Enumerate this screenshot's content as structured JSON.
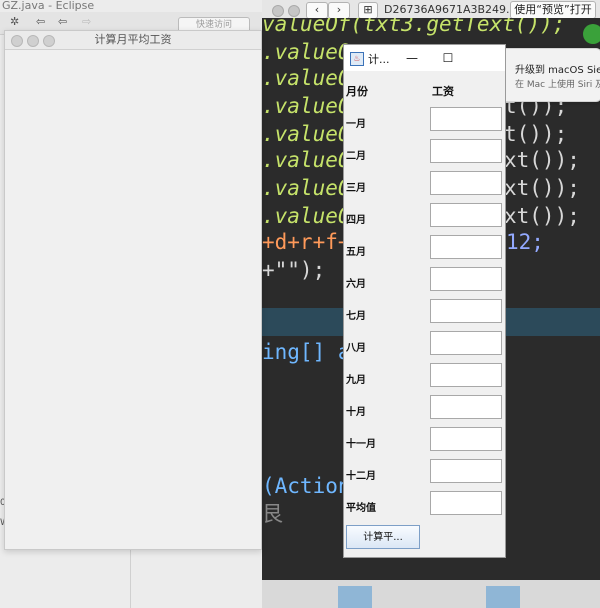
{
  "eclipse": {
    "title": "GZ.java - Eclipse",
    "quick_access": "快速访问",
    "lower_char_1": "0",
    "lower_char_2": "W"
  },
  "preview": {
    "title": "D26736A9671A3B249...",
    "open_button": "使用“预览”打开"
  },
  "notification": {
    "title": "升级到 macOS Sierra",
    "body": "在 Mac 上使用 Siri 及"
  },
  "code": {
    "line1": "valueOf(txt3.getText());",
    "line2": ".valueO",
    "line2b": "t());",
    "line3": ".valueO",
    "line4": ".valueO",
    "line4b": "t());",
    "line5": ".valueO",
    "line5b": "t());",
    "line6": ".valueO",
    "line6b": "xt());",
    "line7": ".valueO",
    "line7b": "xt());",
    "line8": ".valueO",
    "line8b": "xt());",
    "line9": "+d+r+f+",
    "line9b": "12;",
    "line10": "+\"\");",
    "line11": "ing[] a",
    "line12": "(Action",
    "line13": "艮"
  },
  "left_frame": {
    "title": "计算月平均工资"
  },
  "salary_window": {
    "title": "计...",
    "minimize": "—",
    "maximize": "☐",
    "header_month": "月份",
    "header_salary": "工资",
    "months": [
      "一月",
      "二月",
      "三月",
      "四月",
      "五月",
      "六月",
      "七月",
      "八月",
      "九月",
      "十月",
      "十一月",
      "十二月"
    ],
    "average_label": "平均值",
    "calc_button": "计算平..."
  }
}
